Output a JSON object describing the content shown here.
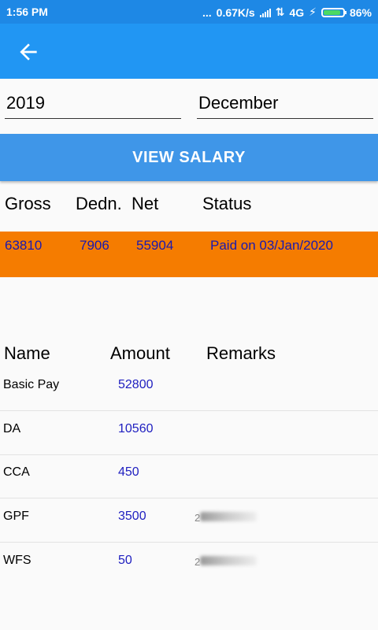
{
  "status_bar": {
    "time": "1:56 PM",
    "dots": "...",
    "speed": "0.67K/s",
    "network": "4G",
    "battery": "86%",
    "battery_level": 0.86
  },
  "form": {
    "year": "2019",
    "month": "December",
    "view_button": "VIEW SALARY"
  },
  "summary": {
    "headers": {
      "gross": "Gross",
      "dedn": "Dedn.",
      "net": "Net",
      "status": "Status"
    },
    "values": {
      "gross": "63810",
      "dedn": "7906",
      "net": "55904",
      "status": "Paid on 03/Jan/2020"
    }
  },
  "details": {
    "headers": {
      "name": "Name",
      "amount": "Amount",
      "remarks": "Remarks"
    },
    "rows": [
      {
        "name": "Basic Pay",
        "amount": "52800"
      },
      {
        "name": "DA",
        "amount": "10560"
      },
      {
        "name": "CCA",
        "amount": "450"
      },
      {
        "name": "GPF",
        "amount": "3500",
        "remarks": "2"
      },
      {
        "name": "WFS",
        "amount": "50",
        "remarks": "2"
      }
    ]
  }
}
